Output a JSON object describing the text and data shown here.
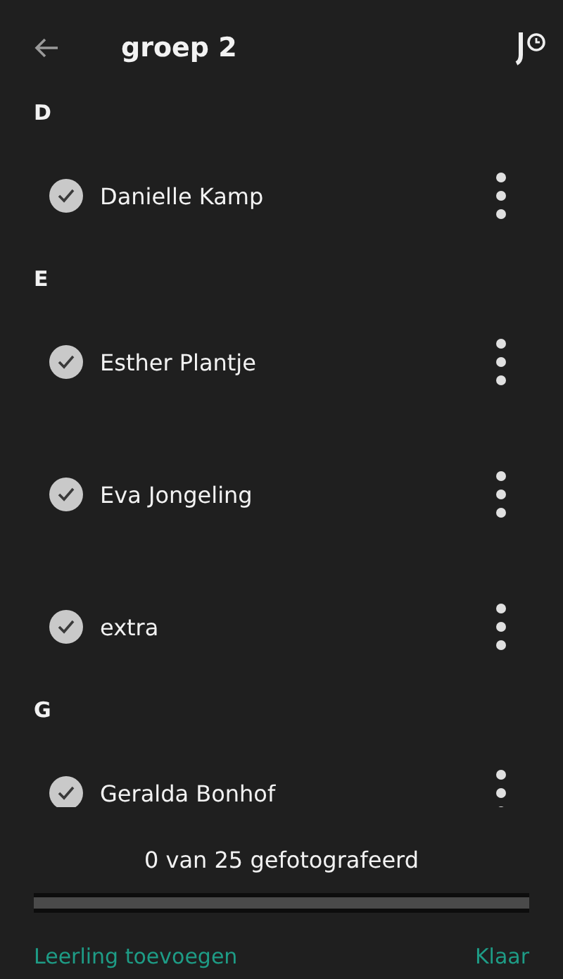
{
  "header": {
    "title": "groep 2"
  },
  "sections": [
    {
      "letter": "D",
      "students": [
        {
          "name": "Danielle Kamp",
          "checked": true
        }
      ]
    },
    {
      "letter": "E",
      "students": [
        {
          "name": "Esther Plantje",
          "checked": true
        },
        {
          "name": "Eva Jongeling",
          "checked": true
        },
        {
          "name": "extra",
          "checked": true
        }
      ]
    },
    {
      "letter": "G",
      "students": [
        {
          "name": "Geralda Bonhof",
          "checked": true
        }
      ]
    }
  ],
  "footer": {
    "status": "0 van 25 gefotografeerd",
    "progress": {
      "level": 0
    },
    "add_link": "Leerling toevoegen",
    "done_link": "Klaar"
  }
}
